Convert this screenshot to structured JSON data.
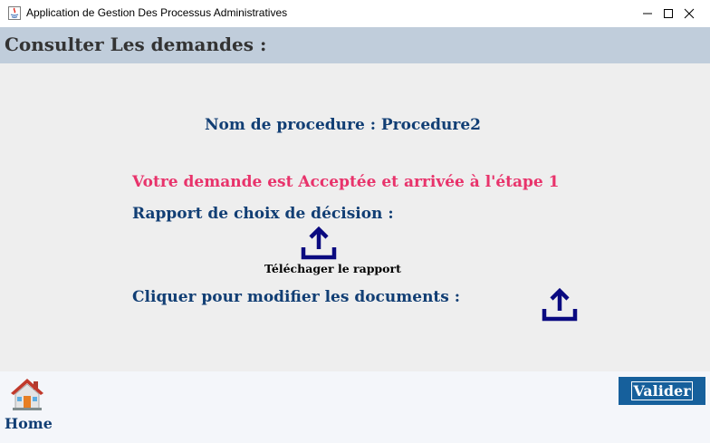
{
  "window": {
    "title": "Application de Gestion Des Processus Administratives"
  },
  "header": {
    "title": "Consulter Les demandes :"
  },
  "main": {
    "procedure_label": "Nom de procedure : Procedure2",
    "status_message": "Votre demande est Acceptée et arrivée à l'étape 1",
    "rapport_label": "Rapport de choix de décision :",
    "download_label": "Téléchager le rapport",
    "modify_label": "Cliquer pour modifier les documents :"
  },
  "footer": {
    "home_label": "Home",
    "valider_label": "Valider"
  },
  "icons": {
    "app": "java-app-icon",
    "minimize": "minimize-icon",
    "maximize": "maximize-icon",
    "close": "close-icon",
    "upload": "upload-icon",
    "home": "home-icon"
  },
  "colors": {
    "header_band": "#c0cddb",
    "main_background": "#eeeeee",
    "label_blue": "#113e74",
    "status_pink": "#e8336b",
    "icon_navy": "#0a0a80",
    "button_blue": "#16609c"
  }
}
